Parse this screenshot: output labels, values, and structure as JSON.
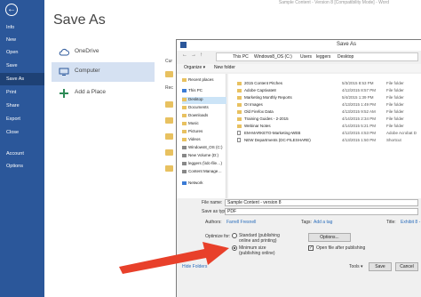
{
  "window": {
    "title": "Sample Content - Version 8 [Compatibility Mode] - Word"
  },
  "backstage": {
    "back_glyph": "←",
    "items": [
      {
        "label": "Info"
      },
      {
        "label": "New"
      },
      {
        "label": "Open"
      },
      {
        "label": "Save"
      },
      {
        "label": "Save As"
      },
      {
        "label": "Print"
      },
      {
        "label": "Share"
      },
      {
        "label": "Export"
      },
      {
        "label": "Close"
      },
      {
        "label": "Account"
      },
      {
        "label": "Options"
      }
    ]
  },
  "page_title": "Save As",
  "places": [
    {
      "label": "OneDrive",
      "icon": "cloud-icon"
    },
    {
      "label": "Computer",
      "icon": "computer-icon"
    },
    {
      "label": "Add a Place",
      "icon": "plus-icon"
    }
  ],
  "right_col": {
    "current_label": "Cur",
    "recent_label": "Rec"
  },
  "dialog": {
    "title": "Save As",
    "address": [
      "This PC",
      "Windows8_OS (C:)",
      "Users",
      "leggers",
      "Desktop"
    ],
    "toolbar": {
      "organize": "Organize ▾",
      "new_folder": "New folder"
    },
    "nav": [
      {
        "label": "Recent places",
        "kind": "folder"
      },
      {
        "label": "This PC",
        "kind": "pc"
      },
      {
        "label": "Desktop",
        "kind": "folder",
        "selected": true
      },
      {
        "label": "Documents",
        "kind": "folder"
      },
      {
        "label": "Downloads",
        "kind": "folder"
      },
      {
        "label": "Music",
        "kind": "folder"
      },
      {
        "label": "Pictures",
        "kind": "folder"
      },
      {
        "label": "Videos",
        "kind": "folder"
      },
      {
        "label": "Windows8_OS (C:)",
        "kind": "drive"
      },
      {
        "label": "New Volume (D:)",
        "kind": "drive"
      },
      {
        "label": "leggers (\\\\dc-file…)",
        "kind": "drive"
      },
      {
        "label": "Content Manage…",
        "kind": "drive"
      },
      {
        "label": "Network",
        "kind": "pc"
      }
    ],
    "files": [
      {
        "name": "2015 Content Pitches",
        "date": "5/3/2015 8:53 PM",
        "type": "File folder",
        "kind": "folder"
      },
      {
        "name": "Adobe Captivate8",
        "date": "4/12/2015 8:57 PM",
        "type": "File folder",
        "kind": "folder"
      },
      {
        "name": "Marketing Monthly Reports",
        "date": "5/4/2015 1:39 PM",
        "type": "File folder",
        "kind": "folder"
      },
      {
        "name": "OI Images",
        "date": "4/13/2015 1:49 PM",
        "type": "File folder",
        "kind": "folder"
      },
      {
        "name": "Old Firefox Data",
        "date": "4/13/2015 9:52 AM",
        "type": "File folder",
        "kind": "folder"
      },
      {
        "name": "Training Guides - 2-2015",
        "date": "4/14/2015 2:34 PM",
        "type": "File folder",
        "kind": "folder"
      },
      {
        "name": "Webinar Notes",
        "date": "4/14/2015 5:21 PM",
        "type": "File folder",
        "kind": "folder"
      },
      {
        "name": "EM-MARKETO-Marketing-WEB",
        "date": "4/12/2015 4:53 PM",
        "type": "Adobe Acrobat D",
        "kind": "doc"
      },
      {
        "name": "NEW Departments (DC-FILESHARE)",
        "date": "4/13/2015 1:50 PM",
        "type": "Shortcut",
        "kind": "doc"
      }
    ],
    "form": {
      "file_name_label": "File name:",
      "file_name_value": "Sample Content - version 8",
      "save_type_label": "Save as type:",
      "save_type_value": "PDF",
      "authors_label": "Authors:",
      "authors_value": "Farrell Fresnell",
      "tags_label": "Tags:",
      "tags_value": "Add a tag",
      "title_label": "Title:",
      "title_value": "Exhibit 8 -",
      "optimize_label": "Optimize for:",
      "opt_standard": "Standard (publishing online and printing)",
      "opt_minimum": "Minimum size (publishing online)",
      "options_button": "Options...",
      "open_after": "Open file after publishing",
      "open_after_checked": "✓",
      "hide_folders": "Hide Folders",
      "tools": "Tools ▾",
      "save": "Save",
      "cancel": "Cancel"
    }
  },
  "colors": {
    "word_blue": "#2b579a",
    "arrow_red": "#e8402a"
  }
}
